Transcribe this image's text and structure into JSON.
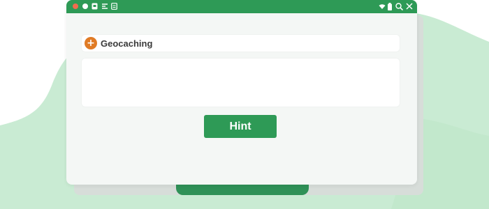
{
  "colors": {
    "titlebar": "#2e9a56",
    "accent_orange": "#e07b25",
    "button": "#2e9a56",
    "background_blob": "#c9ebd3",
    "window_bg": "#f4f7f5"
  },
  "titlebar": {
    "left_icons": [
      "close-dot-icon",
      "circle-icon",
      "notification-icon",
      "cast-icon",
      "clipboard-icon"
    ],
    "right_icons": [
      "wifi-icon",
      "battery-icon",
      "search-icon",
      "close-icon"
    ]
  },
  "header": {
    "icon": "plus-icon",
    "icon_glyph": "+",
    "label": "Geocaching"
  },
  "content": {
    "text": ""
  },
  "actions": {
    "hint_label": "Hint"
  }
}
